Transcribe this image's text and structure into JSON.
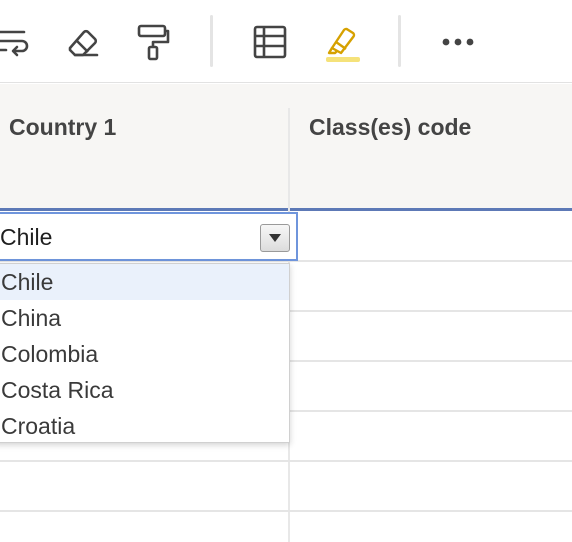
{
  "toolbar": {
    "buttons": [
      {
        "icon": "wrap-text-icon"
      },
      {
        "icon": "eraser-icon"
      },
      {
        "icon": "paint-roller-icon"
      },
      {
        "icon": "table-icon"
      },
      {
        "icon": "highlighter-icon"
      },
      {
        "icon": "more-icon"
      }
    ]
  },
  "header": {
    "columns": [
      {
        "title": "Country 1"
      },
      {
        "title": "Class(es) code"
      }
    ]
  },
  "cell_editor": {
    "value": "Chile"
  },
  "dropdown": {
    "options": [
      "Chile",
      "China",
      "Colombia",
      "Costa Rica",
      "Croatia"
    ],
    "selected": "Chile"
  },
  "colors": {
    "accent": "#5d79b6",
    "editor_border": "#6f95dc",
    "highlight": "#f5e27a",
    "selected_option_bg": "#eaf1fb"
  }
}
